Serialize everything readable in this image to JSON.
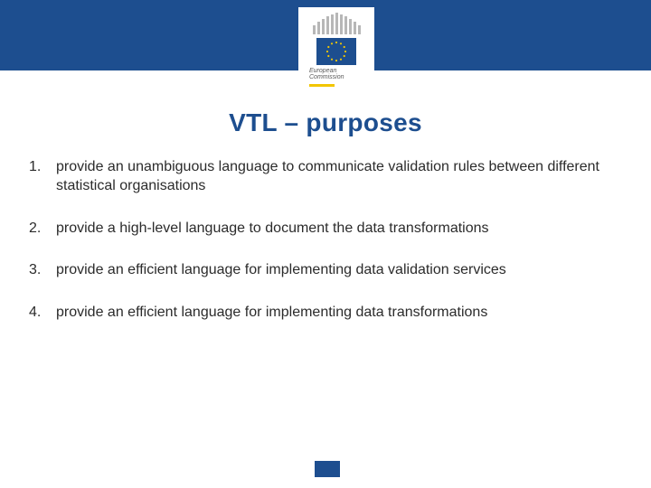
{
  "logo": {
    "line1": "European",
    "line2": "Commission"
  },
  "title": "VTL – purposes",
  "items": [
    "provide an unambiguous language to communicate validation rules between different statistical organisations",
    "provide a high-level language to document the data transformations",
    "provide an efficient language for implementing data validation services",
    "provide an efficient language for implementing data transformations"
  ]
}
